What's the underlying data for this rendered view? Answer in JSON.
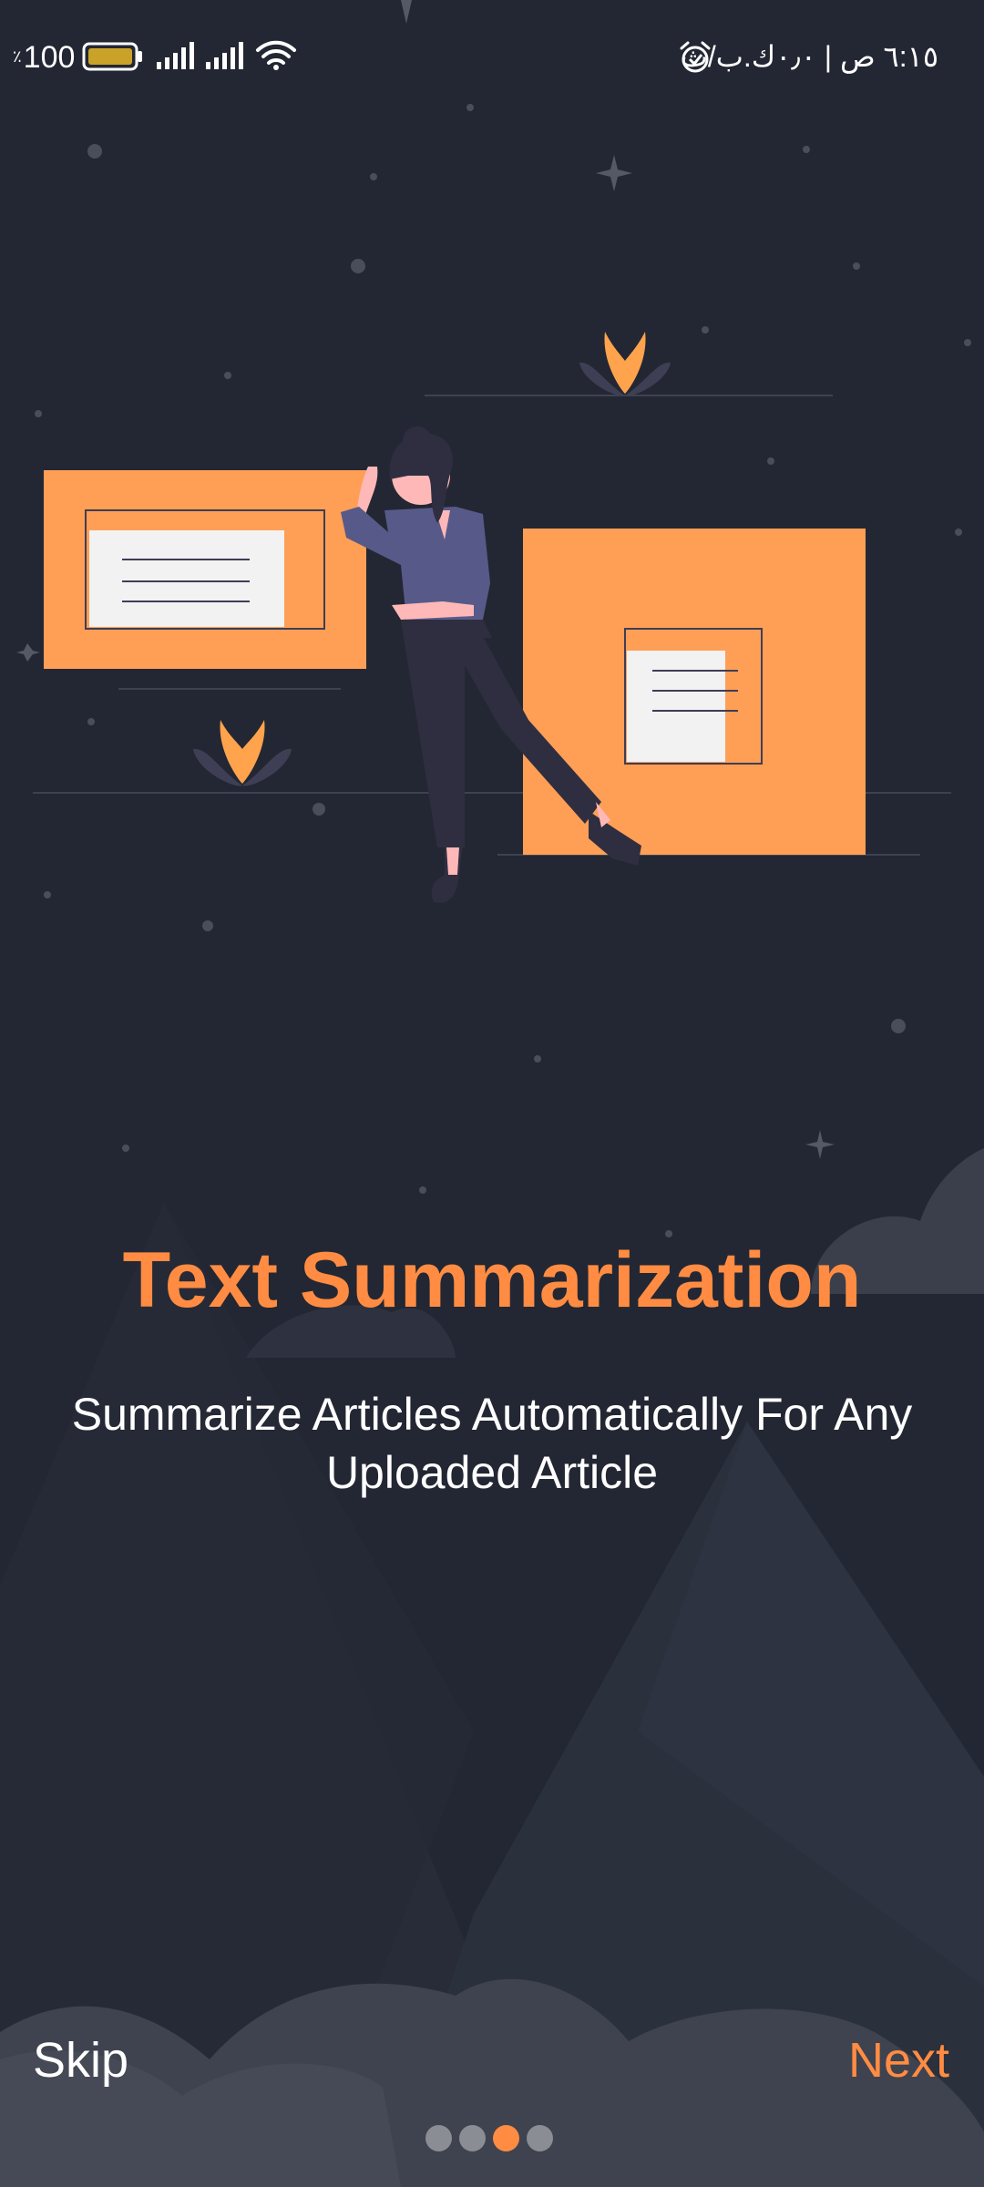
{
  "status_bar": {
    "battery_percent": "100",
    "battery_percent_sign": "٪",
    "right_text": "٦:١٥ ص | ٠٫٠ك.ب/ث",
    "icons": [
      "battery-icon",
      "signal-icon",
      "signal-icon",
      "wifi-icon",
      "alarm-icon"
    ]
  },
  "onboarding": {
    "title": "Text Summarization",
    "subtitle": "Summarize Articles Automatically For Any Uploaded Article",
    "skip_label": "Skip",
    "next_label": "Next",
    "total_pages": 4,
    "current_page": 3
  },
  "colors": {
    "background": "#232733",
    "accent": "#ff8c42",
    "text": "#ffffff",
    "inactive_dot": "#8a8d94"
  }
}
